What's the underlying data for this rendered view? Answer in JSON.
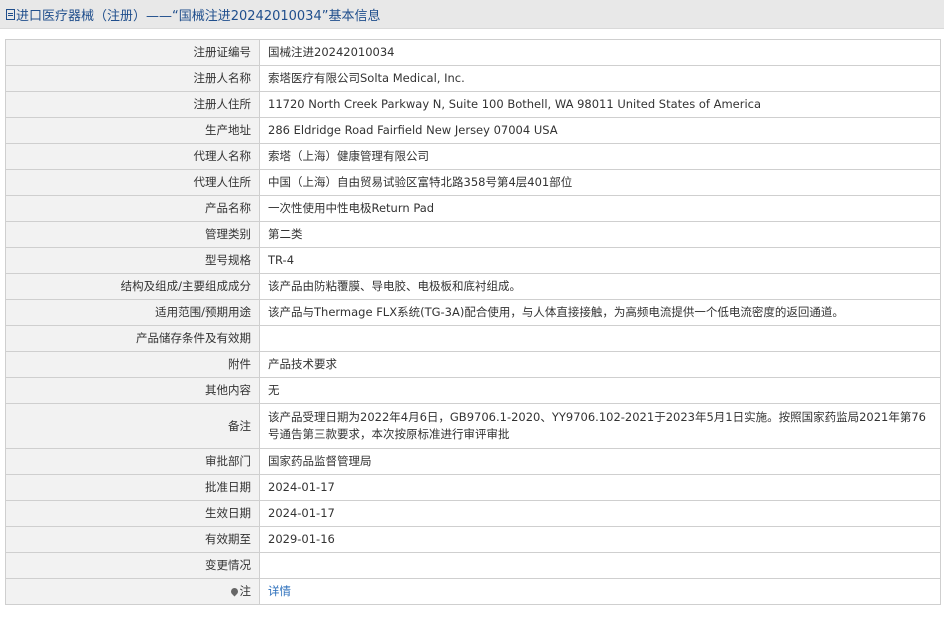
{
  "header": {
    "title": "进口医疗器械（注册）——“国械注进20242010034”基本信息"
  },
  "rows": [
    {
      "label": "注册证编号",
      "value": "国械注进20242010034"
    },
    {
      "label": "注册人名称",
      "value": "索塔医疗有限公司Solta Medical, Inc."
    },
    {
      "label": "注册人住所",
      "value": "11720 North Creek Parkway N, Suite 100 Bothell, WA 98011 United States of America"
    },
    {
      "label": "生产地址",
      "value": "286 Eldridge Road Fairfield New Jersey 07004 USA"
    },
    {
      "label": "代理人名称",
      "value": "索塔（上海）健康管理有限公司"
    },
    {
      "label": "代理人住所",
      "value": "中国（上海）自由贸易试验区富特北路358号第4层401部位"
    },
    {
      "label": "产品名称",
      "value": "一次性使用中性电极Return Pad"
    },
    {
      "label": "管理类别",
      "value": "第二类"
    },
    {
      "label": "型号规格",
      "value": "TR-4"
    },
    {
      "label": "结构及组成/主要组成成分",
      "value": "该产品由防粘覆膜、导电胶、电极板和底衬组成。"
    },
    {
      "label": "适用范围/预期用途",
      "value": "该产品与Thermage FLX系统(TG-3A)配合使用，与人体直接接触，为高频电流提供一个低电流密度的返回通道。"
    },
    {
      "label": "产品储存条件及有效期",
      "value": ""
    },
    {
      "label": "附件",
      "value": "产品技术要求"
    },
    {
      "label": "其他内容",
      "value": "无"
    },
    {
      "label": "备注",
      "value": "该产品受理日期为2022年4月6日，GB9706.1-2020、YY9706.102-2021于2023年5月1日实施。按照国家药监局2021年第76号通告第三款要求，本次按原标准进行审评审批"
    },
    {
      "label": "审批部门",
      "value": "国家药品监督管理局"
    },
    {
      "label": "批准日期",
      "value": "2024-01-17"
    },
    {
      "label": "生效日期",
      "value": "2024-01-17"
    },
    {
      "label": "有效期至",
      "value": "2029-01-16"
    },
    {
      "label": "变更情况",
      "value": ""
    }
  ],
  "note": {
    "label": "注",
    "icon": "pin-icon",
    "link_text": "详情"
  },
  "colors": {
    "label_bg": "#f2f2f2",
    "border": "#cfcfcf",
    "header_bg": "#e8e8e8",
    "header_text": "#1f4e8c",
    "link": "#2a6ebb"
  }
}
